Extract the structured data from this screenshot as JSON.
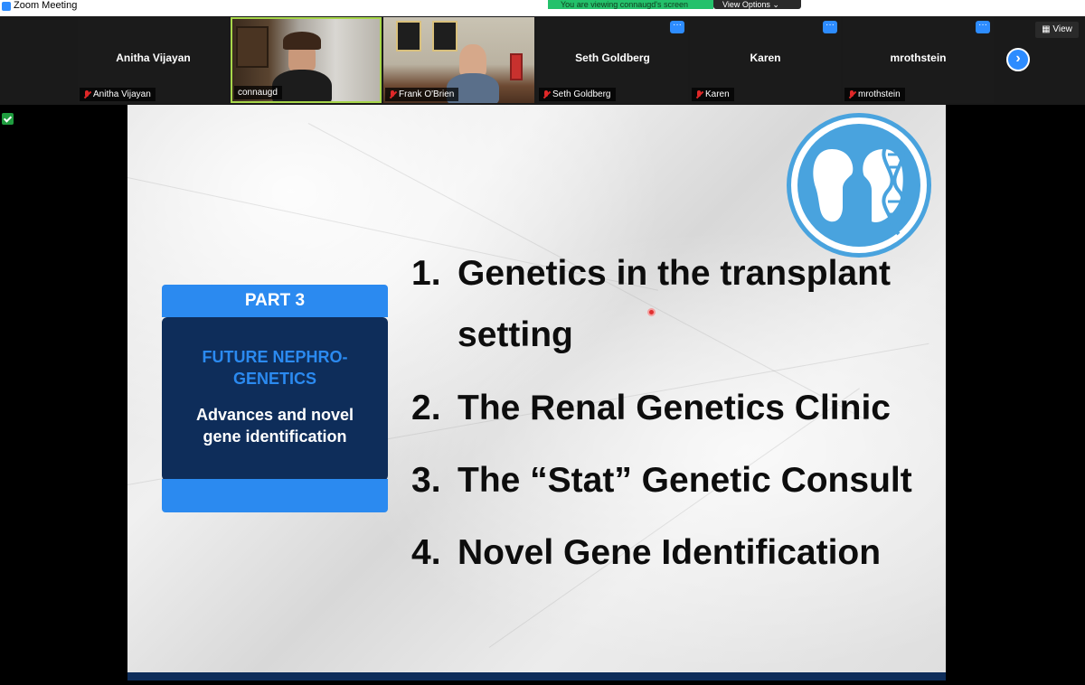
{
  "window": {
    "title": "Zoom Meeting"
  },
  "banner": {
    "viewing_text": "You are viewing connaugd's screen",
    "view_options_label": "View Options ⌄"
  },
  "gallery": {
    "participants": [
      {
        "name": "Anitha Vijayan",
        "label": "Anitha Vijayan",
        "video": false,
        "muted": true
      },
      {
        "name": "connaugd",
        "label": "connaugd",
        "video": true,
        "muted": false
      },
      {
        "name": "Frank O'Brien",
        "label": "Frank O'Brien",
        "video": true,
        "muted": true
      },
      {
        "name": "Seth Goldberg",
        "label": "Seth Goldberg",
        "video": false,
        "muted": true
      },
      {
        "name": "Karen",
        "label": "Karen",
        "video": false,
        "muted": true
      },
      {
        "name": "mrothstein",
        "label": "mrothstein",
        "video": false,
        "muted": true
      }
    ],
    "view_label": "View",
    "next_icon": "chevron-right-icon"
  },
  "slide": {
    "part_label": "PART 3",
    "future_line1": "FUTURE NEPHRO-",
    "future_line2": "GENETICS",
    "advances_line1": "Advances and novel",
    "advances_line2": "gene identification",
    "items": [
      {
        "num": "1.",
        "text": "Genetics in the transplant setting"
      },
      {
        "num": "2.",
        "text": "The Renal Genetics Clinic"
      },
      {
        "num": "3.",
        "text": "The “Stat” Genetic Consult"
      },
      {
        "num": "4.",
        "text": "Novel Gene Identification"
      }
    ],
    "logo_icon": "kidney-dna-logo",
    "colors": {
      "accent_blue": "#2b8af0",
      "navy": "#0e2d5a",
      "logo_blue": "#49a3de"
    }
  }
}
